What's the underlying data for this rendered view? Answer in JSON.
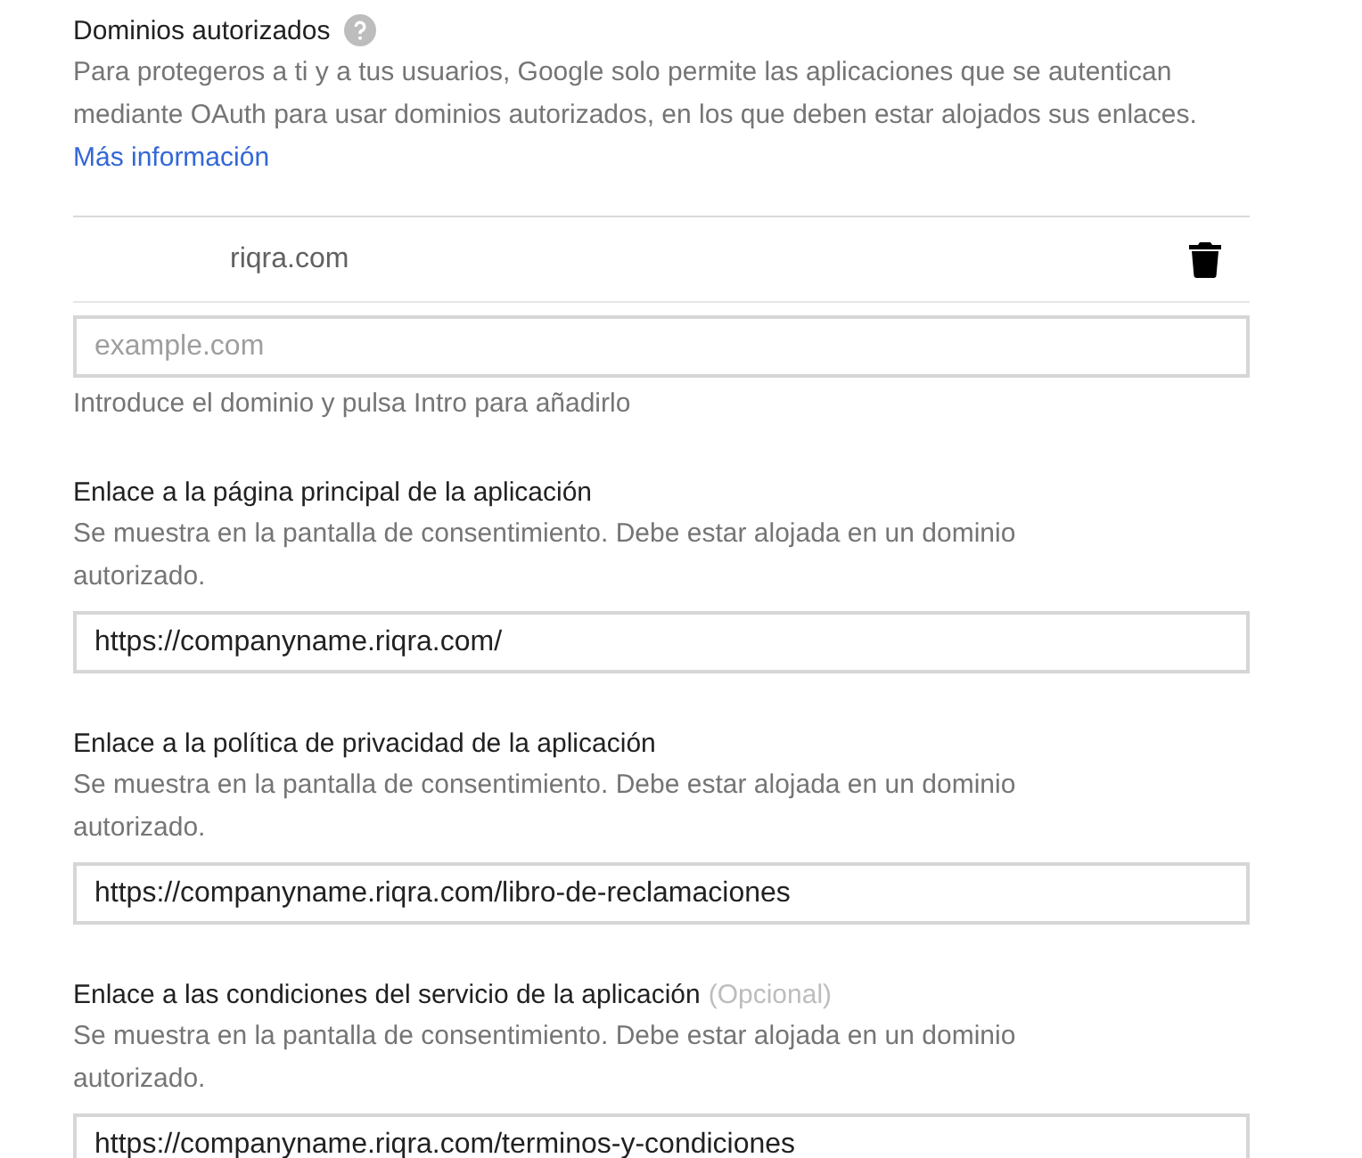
{
  "domains_section": {
    "title": "Dominios autorizados",
    "description": "Para protegeros a ti y a tus usuarios, Google solo permite las aplicaciones que se autentican mediante OAuth para usar dominios autorizados, en los que deben estar alojados sus enlaces.",
    "link": "Más información",
    "domains": [
      {
        "name": "riqra.com"
      }
    ],
    "new_domain": {
      "placeholder": "example.com"
    },
    "hint": "Introduce el dominio y pulsa Intro para añadirlo"
  },
  "fields": [
    {
      "label": "Enlace a la página principal de la aplicación",
      "description": "Se muestra en la pantalla de consentimiento. Debe estar alojada en un dominio autorizado.",
      "value": "https://companyname.riqra.com/"
    },
    {
      "label": "Enlace a la política de privacidad de la aplicación",
      "description": "Se muestra en la pantalla de consentimiento. Debe estar alojada en un dominio autorizado.",
      "value": "https://companyname.riqra.com/libro-de-reclamaciones"
    },
    {
      "label": "Enlace a las condiciones del servicio de la aplicación",
      "optional_note": "(Opcional)",
      "description": "Se muestra en la pantalla de consentimiento. Debe estar alojada en un dominio autorizado.",
      "value": "https://companyname.riqra.com/terminos-y-condiciones"
    }
  ]
}
